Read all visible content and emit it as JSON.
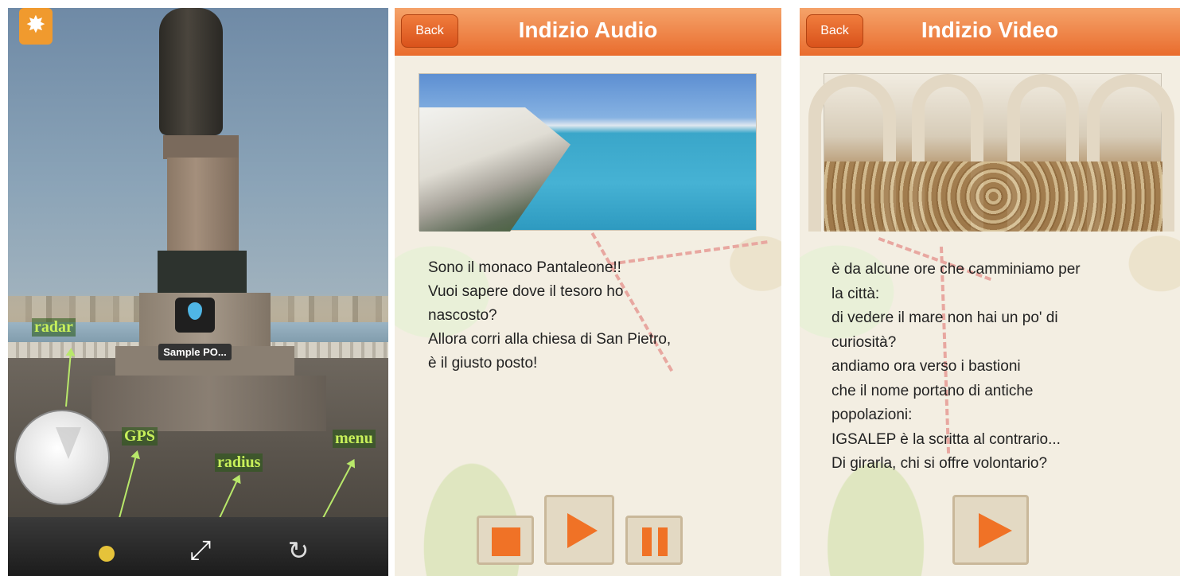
{
  "ar_view": {
    "poi_label": "Sample PO...",
    "annotations": {
      "radar": "radar",
      "gps": "GPS",
      "radius": "radius",
      "menu": "menu"
    },
    "toolbar_icons": [
      "gps-dot-icon",
      "radius-resize-icon",
      "refresh-icon"
    ]
  },
  "audio_clue": {
    "back_label": "Back",
    "title": "Indizio Audio",
    "text_lines": [
      "Sono il monaco Pantaleone!!",
      "Vuoi sapere dove il tesoro ho",
      "nascosto?",
      "Allora corri alla chiesa di San Pietro,",
      "è il giusto posto!"
    ],
    "controls": [
      "stop-icon",
      "play-icon",
      "pause-icon"
    ]
  },
  "video_clue": {
    "back_label": "Back",
    "title": "Indizio Video",
    "text_lines": [
      "è da alcune ore che camminiamo per",
      "la città:",
      "di vedere il mare non hai un po' di",
      "curiosità?",
      "andiamo ora verso i bastioni",
      "che il nome portano di antiche",
      "popolazioni:",
      "IGSALEP è la scritta al contrario...",
      "Di girarla, chi si offre volontario?"
    ],
    "controls": [
      "play-icon"
    ]
  },
  "colors": {
    "header_orange": "#e96c2d",
    "accent_orange": "#f07226",
    "annotation_green": "#c8f05a"
  }
}
